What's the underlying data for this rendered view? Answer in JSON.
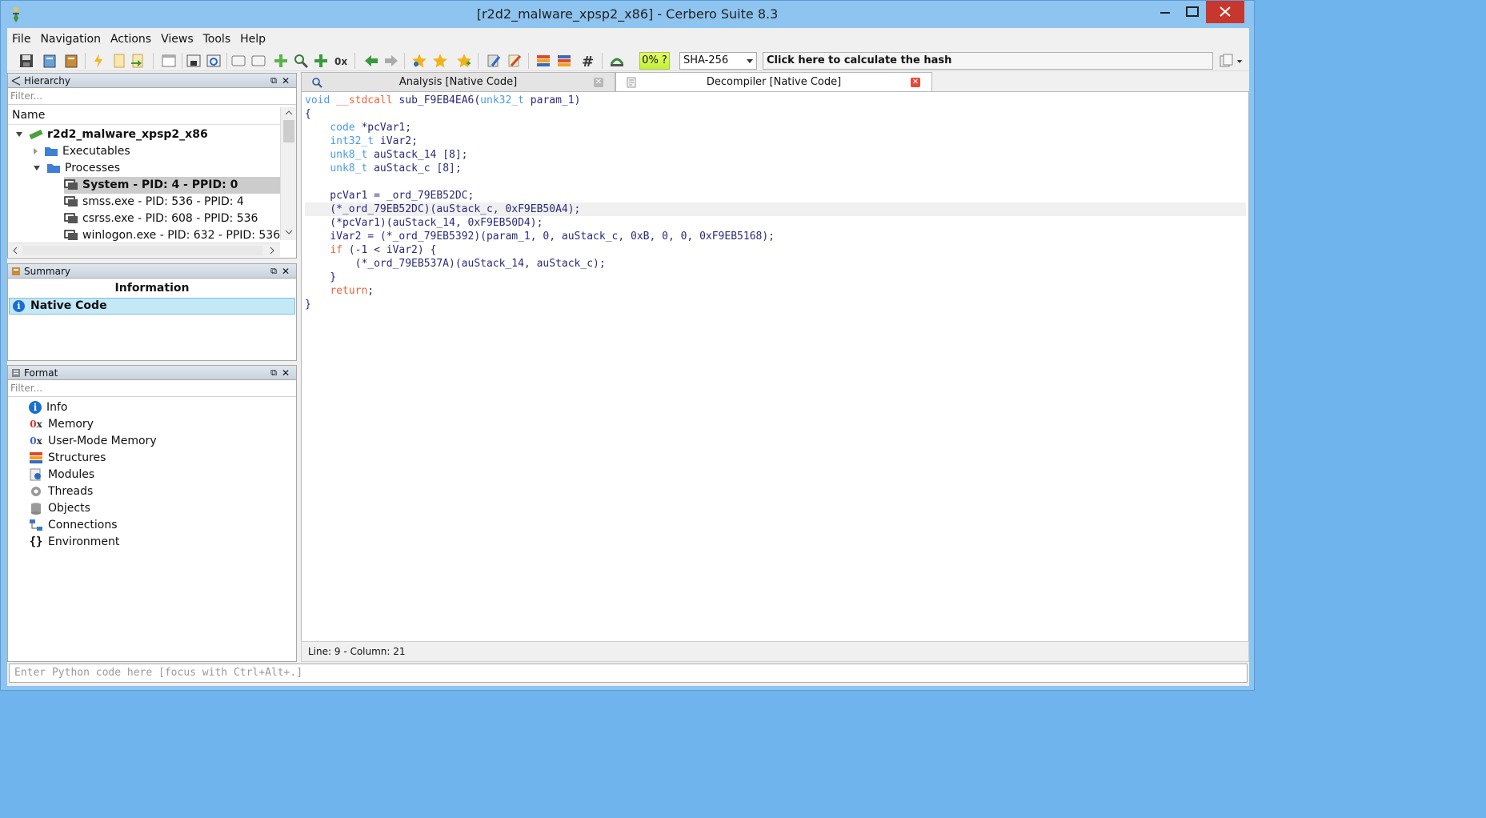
{
  "window": {
    "title": "[r2d2_malware_xpsp2_x86] - Cerbero Suite 8.3"
  },
  "menu": [
    "File",
    "Navigation",
    "Actions",
    "Views",
    "Tools",
    "Help"
  ],
  "toolbar": {
    "progress": "0% ?",
    "hash_algo": "SHA-256",
    "hash_prompt": "Click here to calculate the hash"
  },
  "hierarchy": {
    "title": "Hierarchy",
    "filter_placeholder": "Filter...",
    "column": "Name",
    "root": "r2d2_malware_xpsp2_x86",
    "nodes": [
      {
        "label": "Executables"
      },
      {
        "label": "Processes"
      },
      {
        "label": "System - PID: 4 - PPID: 0"
      },
      {
        "label": "smss.exe - PID: 536 - PPID: 4"
      },
      {
        "label": "csrss.exe - PID: 608 - PPID: 536"
      },
      {
        "label": "winlogon.exe - PID: 632 - PPID: 536"
      }
    ]
  },
  "summary": {
    "title": "Summary",
    "header": "Information",
    "row": "Native Code"
  },
  "format": {
    "title": "Format",
    "filter_placeholder": "Filter...",
    "items": [
      {
        "label": "Info",
        "icon": "info-icon"
      },
      {
        "label": "Memory",
        "icon": "hex-icon"
      },
      {
        "label": "User-Mode Memory",
        "icon": "hex-icon"
      },
      {
        "label": "Structures",
        "icon": "structures-icon"
      },
      {
        "label": "Modules",
        "icon": "modules-icon"
      },
      {
        "label": "Threads",
        "icon": "gear-icon"
      },
      {
        "label": "Objects",
        "icon": "objects-icon"
      },
      {
        "label": "Connections",
        "icon": "network-icon"
      },
      {
        "label": "Environment",
        "icon": "braces-icon"
      }
    ]
  },
  "tabs": [
    {
      "label": "Analysis [Native Code]"
    },
    {
      "label": "Decompiler [Native Code]"
    }
  ],
  "code": {
    "lines": [
      [
        [
          "kw",
          "void "
        ],
        [
          "kw2",
          "__stdcall "
        ],
        [
          "",
          "sub_F9EB4EA6("
        ],
        [
          "ty",
          "unk32_t"
        ],
        [
          "",
          " param_1)"
        ]
      ],
      [
        [
          "",
          "{"
        ]
      ],
      [
        [
          "",
          "    "
        ],
        [
          "ty",
          "code"
        ],
        [
          "",
          " *pcVar1;"
        ]
      ],
      [
        [
          "",
          "    "
        ],
        [
          "ty",
          "int32_t"
        ],
        [
          "",
          " iVar2;"
        ]
      ],
      [
        [
          "",
          "    "
        ],
        [
          "ty",
          "unk8_t"
        ],
        [
          "",
          " auStack_14 [8];"
        ]
      ],
      [
        [
          "",
          "    "
        ],
        [
          "ty",
          "unk8_t"
        ],
        [
          "",
          " auStack_c [8];"
        ]
      ],
      [
        [
          "",
          ""
        ]
      ],
      [
        [
          "",
          "    pcVar1 = _ord_79EB52DC;"
        ]
      ],
      [
        [
          "",
          "    (*_ord_79EB52DC)(auStack_c, 0xF9EB50A4);"
        ]
      ],
      [
        [
          "",
          "    (*pcVar1)(auStack_14, 0xF9EB50D4);"
        ]
      ],
      [
        [
          "",
          "    iVar2 = (*_ord_79EB5392)(param_1, 0, auStack_c, 0xB, 0, 0, 0xF9EB5168);"
        ]
      ],
      [
        [
          "",
          "    "
        ],
        [
          "kw2",
          "if"
        ],
        [
          "",
          " (-1 < iVar2) {"
        ]
      ],
      [
        [
          "",
          "        (*_ord_79EB537A)(auStack_14, auStack_c);"
        ]
      ],
      [
        [
          "",
          "    }"
        ]
      ],
      [
        [
          "",
          "    "
        ],
        [
          "kw2",
          "return"
        ],
        [
          "",
          ";"
        ]
      ],
      [
        [
          "",
          "}"
        ]
      ]
    ],
    "highlight_line": 8
  },
  "status": {
    "position": "Line: 9 - Column: 21"
  },
  "python": {
    "placeholder": "Enter Python code here [focus with Ctrl+Alt+.]"
  },
  "colors": {
    "titlebar": "#8ec4f0",
    "close": "#c8372d",
    "selection": "#c5e8f7",
    "keyword": "#4a9ae8",
    "keyword2": "#f0643c"
  }
}
